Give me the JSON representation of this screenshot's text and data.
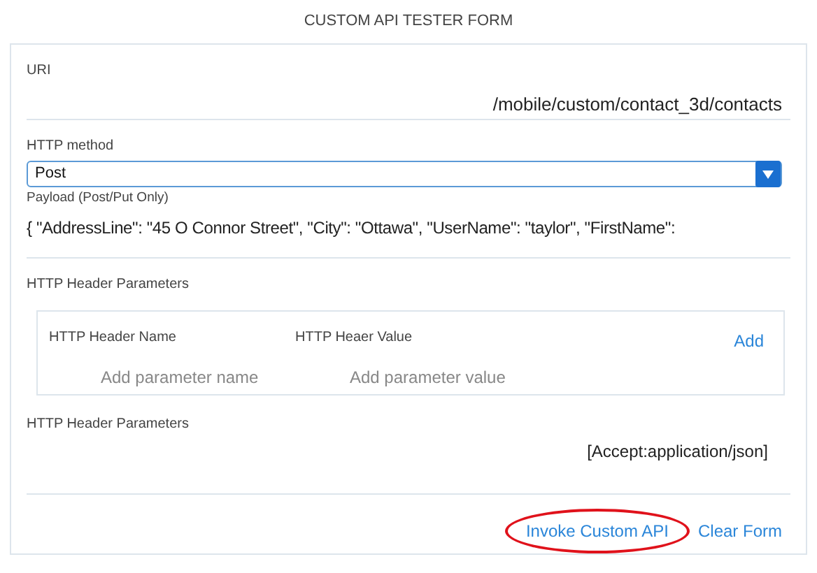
{
  "title": "CUSTOM API TESTER FORM",
  "uri": {
    "label": "URI",
    "value": "/mobile/custom/contact_3d/contacts"
  },
  "method": {
    "label": "HTTP method",
    "value": "Post"
  },
  "payload": {
    "label": "Payload (Post/Put Only)",
    "value": "{ \"AddressLine\": \"45 O Connor Street\",  \"City\": \"Ottawa\",  \"UserName\": \"taylor\", \"FirstName\":"
  },
  "header_editor": {
    "label": "HTTP Header Parameters",
    "name_label": "HTTP Header Name",
    "value_label": "HTTP Heaer Value",
    "add": "Add",
    "name_placeholder": "Add parameter name",
    "value_placeholder": "Add parameter value"
  },
  "headers": {
    "label": "HTTP Header Parameters",
    "value": "[Accept:application/json]"
  },
  "actions": [
    {
      "label": "Invoke Custom API",
      "circled": true
    },
    {
      "label": "Clear Form",
      "circled": false
    }
  ]
}
